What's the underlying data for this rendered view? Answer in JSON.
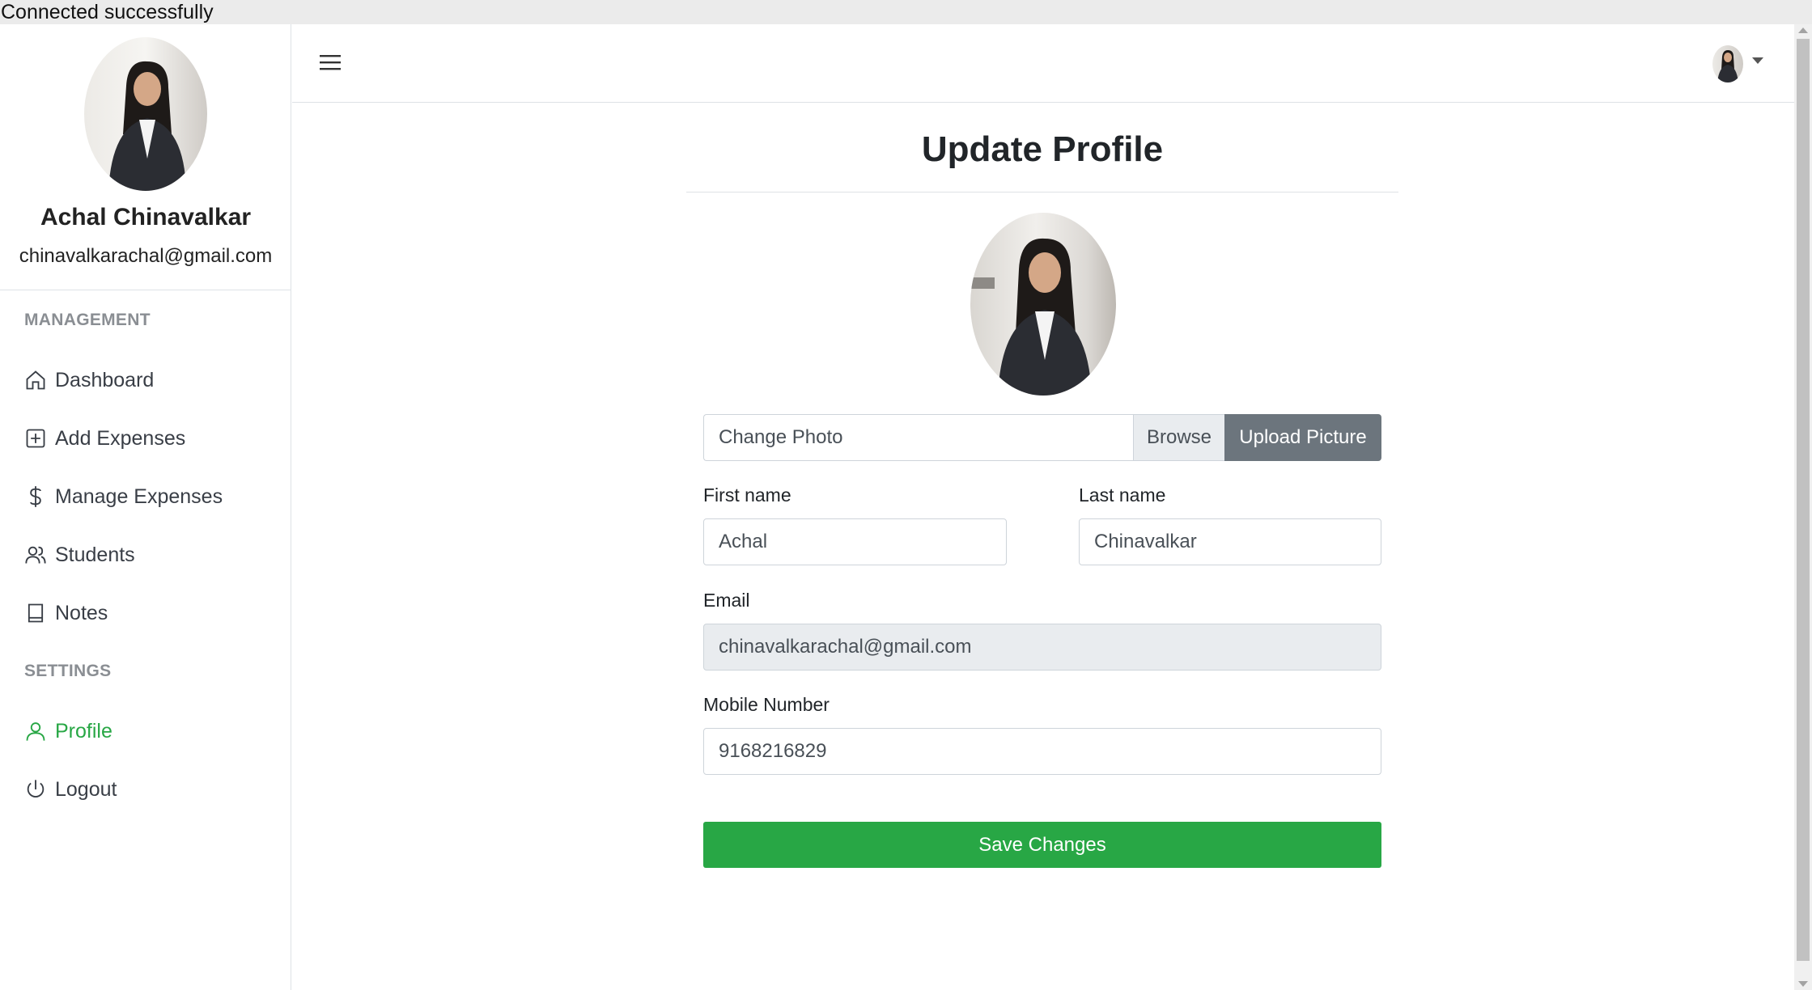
{
  "status_bar": {
    "text": "Connected successfully"
  },
  "sidebar": {
    "user_name": "Achal Chinavalkar",
    "user_email": "chinavalkarachal@gmail.com",
    "sections": [
      {
        "title": "MANAGEMENT"
      },
      {
        "title": "SETTINGS"
      }
    ],
    "items": [
      {
        "label": "Dashboard",
        "icon": "house-icon"
      },
      {
        "label": "Add Expenses",
        "icon": "plus-square-icon"
      },
      {
        "label": "Manage Expenses",
        "icon": "dollar-icon"
      },
      {
        "label": "Students",
        "icon": "people-icon"
      },
      {
        "label": "Notes",
        "icon": "book-icon"
      },
      {
        "label": "Profile",
        "icon": "person-icon",
        "active": true
      },
      {
        "label": "Logout",
        "icon": "power-icon"
      }
    ],
    "active_color": "#28a745"
  },
  "main": {
    "title": "Update Profile",
    "upload": {
      "file_placeholder": "Change Photo",
      "browse_label": "Browse",
      "upload_label": "Upload Picture"
    },
    "form": {
      "first_name_label": "First name",
      "first_name_value": "Achal",
      "last_name_label": "Last name",
      "last_name_value": "Chinavalkar",
      "email_label": "Email",
      "email_value": "chinavalkarachal@gmail.com",
      "mobile_label": "Mobile Number",
      "mobile_value": "9168216829"
    },
    "save_label": "Save Changes",
    "save_color": "#28a745"
  }
}
